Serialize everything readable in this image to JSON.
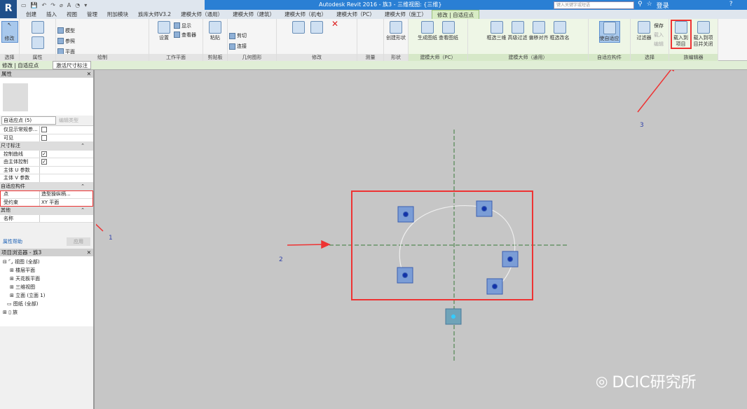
{
  "app": {
    "title": "Autodesk Revit 2016 -     族3 - 三维视图: {三维}",
    "search_placeholder": "键入关键字或短语",
    "login": "登录"
  },
  "tabs": [
    "创建",
    "插入",
    "视图",
    "管理",
    "附加模块",
    "族库大师V3.2",
    "建模大师（通用）",
    "建模大师（建筑）",
    "建模大师（机电）",
    "建模大师（PC）",
    "建模大师（施工）",
    "修改 | 自适应点"
  ],
  "ribbon": {
    "select": {
      "label": "选择",
      "btn": "修改"
    },
    "props": {
      "label": "属性"
    },
    "draw": {
      "label": "绘制",
      "items": [
        "模型",
        "参照",
        "平面"
      ]
    },
    "workplane": {
      "label": "工作平面",
      "items": [
        "设置",
        "显示",
        "查看器"
      ]
    },
    "clipboard": {
      "label": "剪贴板",
      "items": [
        "粘贴"
      ]
    },
    "geometry": {
      "label": "几何图形",
      "items": [
        "剪切",
        "连接"
      ]
    },
    "modify": {
      "label": "修改"
    },
    "measure": {
      "label": "测量"
    },
    "shape": {
      "label": "形状",
      "items": [
        "创建形状"
      ]
    },
    "pc": {
      "label": "建模大师（PC）",
      "items": [
        "生成图纸",
        "查看图纸"
      ]
    },
    "general": {
      "label": "建模大师（通用）",
      "items": [
        "框选三维",
        "高级过滤",
        "偏移对齐",
        "框选改名"
      ]
    },
    "adaptive": {
      "label": "自适应构件",
      "items": [
        "使自适应"
      ]
    },
    "selection": {
      "label": "选择",
      "items": [
        "过滤器",
        "保存",
        "载入",
        "编辑"
      ]
    },
    "familyeditor": {
      "label": "族编辑器",
      "items": [
        "载入到项目",
        "载入到项目并关闭"
      ]
    }
  },
  "context": {
    "left": "修改 | 自适应点",
    "right": "激活尺寸标注"
  },
  "properties": {
    "title": "属性",
    "type": "自适应点 (5)",
    "edit_type": "编辑类型",
    "rows_top": [
      {
        "k": "仅显示常规参...",
        "v": ""
      },
      {
        "k": "可见",
        "v": ""
      }
    ],
    "g1": "尺寸标注",
    "rows_dim": [
      {
        "k": "控制曲线",
        "v": "✓"
      },
      {
        "k": "由主体控制",
        "v": "✓"
      },
      {
        "k": "主体 U 参数",
        "v": ""
      },
      {
        "k": "主体 V 参数",
        "v": ""
      }
    ],
    "g2": "自适应构件",
    "rows_ad": [
      {
        "k": "点",
        "v": "造型操纵柄..."
      },
      {
        "k": "受约束",
        "v": "XY 平面"
      }
    ],
    "g3": "其他",
    "rows_other": [
      {
        "k": "名称",
        "v": ""
      }
    ],
    "help": "属性帮助",
    "apply": "应用"
  },
  "browser": {
    "title": "项目浏览器 - 族3",
    "items": [
      "视图 (全部)",
      "楼层平面",
      "天花板平面",
      "三维视图",
      "立面 (立面 1)",
      "图纸 (全部)",
      "族"
    ]
  },
  "annotations": [
    "1",
    "2",
    "3"
  ],
  "watermark": "DCIC研究所"
}
